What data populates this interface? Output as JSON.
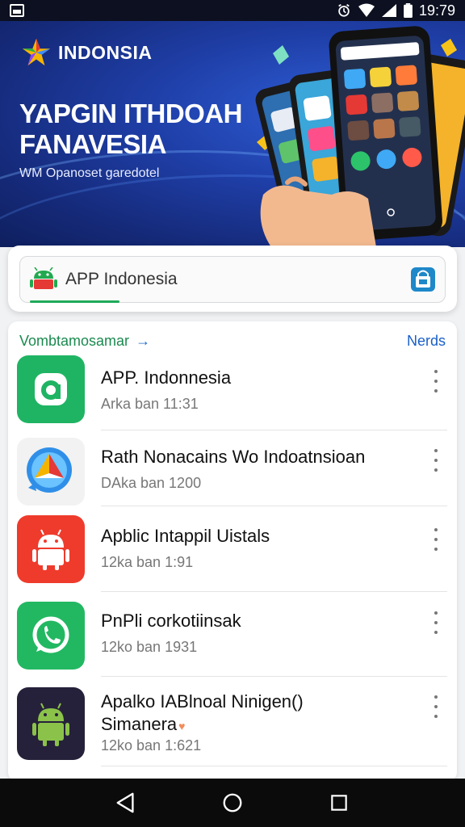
{
  "status_bar": {
    "time": "19:79"
  },
  "banner": {
    "brand": "INDONSIA",
    "headline_line1": "YAPGIN ITHDOAH",
    "headline_line2": "FANAVESIA",
    "subline": "WM Opanoset garedotel"
  },
  "search": {
    "value": "APP Indonesia",
    "progress": 0.22
  },
  "list": {
    "title": "Vombtamosamar",
    "arrow": "→",
    "more": "Nerds",
    "items": [
      {
        "name": "APP. Indonnesia",
        "meta": "Arka ban 11:31"
      },
      {
        "name": "Rath Nonacains Wo Indoatnsioan",
        "meta": "DAka ban 1200"
      },
      {
        "name": "Apblic Intappil Uistals",
        "meta": "12ka ban 1:91"
      },
      {
        "name": "PnPli corkotiinsak",
        "meta": "12ko ban 1931"
      },
      {
        "name": "Apalko IABlnoal Ninigen()",
        "name2": "Simanera",
        "meta": "12ko ban 1:621"
      }
    ]
  },
  "colors": {
    "accent_green": "#1faa59",
    "banner_blue": "#1f3fa8",
    "link_blue": "#1a5fc8"
  },
  "icons": [
    "image-icon",
    "alarm-icon",
    "wifi-icon",
    "signal-icon",
    "battery-icon",
    "android-icon",
    "shopping-bag-icon",
    "back-icon",
    "home-icon",
    "recents-icon"
  ]
}
